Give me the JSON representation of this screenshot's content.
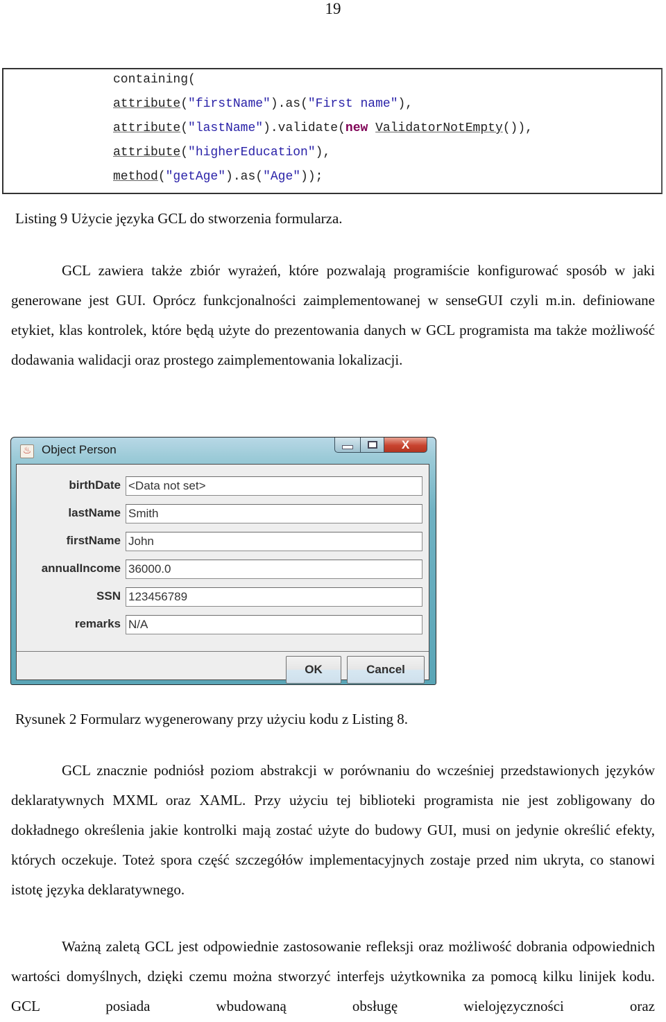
{
  "page_number": "19",
  "listing": {
    "lines": [
      [
        {
          "t": "containing("
        }
      ],
      [
        {
          "t": "attribute",
          "u": true
        },
        {
          "t": "("
        },
        {
          "t": "\"firstName\"",
          "s": "str"
        },
        {
          "t": ").as("
        },
        {
          "t": "\"First name\"",
          "s": "str"
        },
        {
          "t": "),"
        }
      ],
      [
        {
          "t": "attribute",
          "u": true
        },
        {
          "t": "("
        },
        {
          "t": "\"lastName\"",
          "s": "str"
        },
        {
          "t": ").validate("
        },
        {
          "t": "new",
          "s": "kw"
        },
        {
          "t": " "
        },
        {
          "t": "ValidatorNotEmpty",
          "u": true
        },
        {
          "t": "()),"
        }
      ],
      [
        {
          "t": "attribute",
          "u": true
        },
        {
          "t": "("
        },
        {
          "t": "\"higherEducation\"",
          "s": "str"
        },
        {
          "t": "),"
        }
      ],
      [
        {
          "t": "method",
          "u": true
        },
        {
          "t": "("
        },
        {
          "t": "\"getAge\"",
          "s": "str"
        },
        {
          "t": ").as("
        },
        {
          "t": "\"Age\"",
          "s": "str"
        },
        {
          "t": "));"
        }
      ]
    ],
    "caption": "Listing 9 Użycie języka GCL do stworzenia formularza."
  },
  "paragraph1": "GCL zawiera także zbiór wyrażeń, które pozwalają programiście konfigurować sposób w jaki generowane jest GUI. Oprócz funkcjonalności zaimplementowanej w senseGUI czyli m.in.  definiowane etykiet, klas kontrolek, które będą użyte do prezentowania danych w GCL programista ma także możliwość dodawania walidacji oraz prostego zaimplementowania lokalizacji.",
  "figure": {
    "window": {
      "title": "Object Person",
      "app_icon": "java-cup-icon",
      "caption_buttons": {
        "minimize": "minimize-icon",
        "maximize": "maximize-icon",
        "close": "close-icon",
        "close_glyph": "X"
      },
      "fields": [
        {
          "label": "birthDate",
          "value": "<Data not set>"
        },
        {
          "label": "lastName",
          "value": "Smith"
        },
        {
          "label": "firstName",
          "value": "John"
        },
        {
          "label": "annualIncome",
          "value": "36000.0"
        },
        {
          "label": "SSN",
          "value": "123456789"
        },
        {
          "label": "remarks",
          "value": "N/A"
        }
      ],
      "ok_label": "OK",
      "cancel_label": "Cancel"
    },
    "caption": "Rysunek 2 Formularz wygenerowany przy użyciu kodu z Listing 8."
  },
  "paragraph2": "GCL znacznie podniósł poziom abstrakcji w porównaniu do wcześniej przedstawionych języków deklaratywnych MXML oraz XAML. Przy użyciu tej biblioteki programista nie jest zobligowany do dokładnego określenia jakie kontrolki mają zostać użyte do budowy GUI, musi on jedynie określić efekty, których oczekuje. Toteż spora część szczegółów implementacyjnych zostaje przed nim ukryta, co stanowi istotę języka deklaratywnego.",
  "paragraph3": "Ważną zaletą GCL jest odpowiednie zastosowanie refleksji oraz możliwość dobrania odpowiednich wartości domyślnych, dzięki czemu można  stworzyć interfejs użytkownika za pomocą kilku linijek kodu. GCL posiada wbudowaną obsługę wielojęzyczności oraz"
}
